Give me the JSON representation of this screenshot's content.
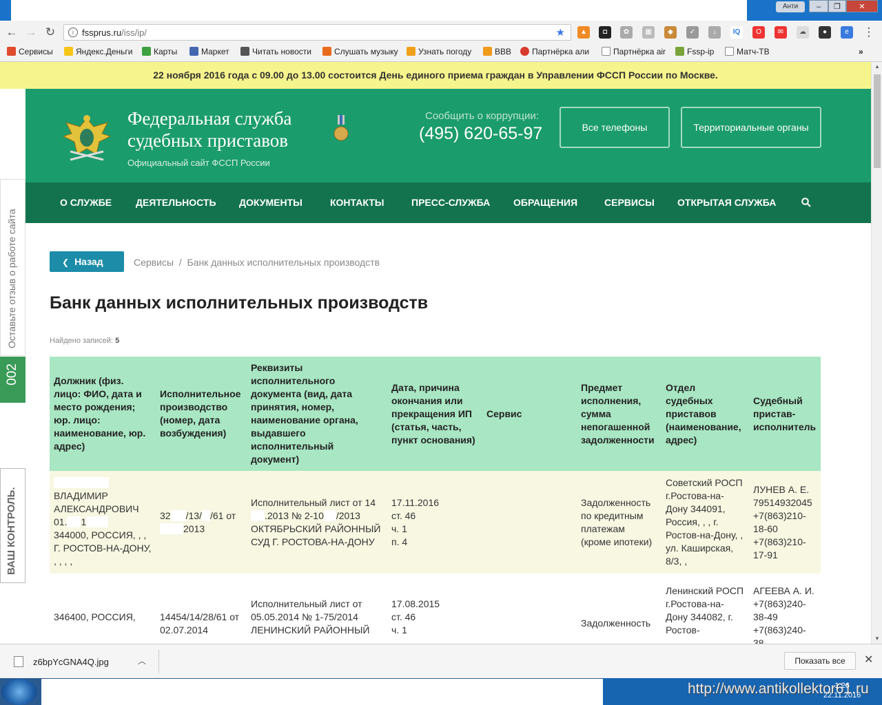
{
  "browser": {
    "titlebar": {
      "anti_label": "Анти",
      "minimize": "–",
      "maximize": "❐",
      "close": "✕"
    },
    "url_host": "fssprus.ru",
    "url_path": "/iss/ip/",
    "bookmarks": [
      {
        "label": "Сервисы",
        "color": "#e04b2e"
      },
      {
        "label": "Яндекс.Деньги",
        "color": "#f5c518"
      },
      {
        "label": "Карты",
        "color": "#3da13f"
      },
      {
        "label": "Маркет",
        "color": "#4468b0"
      },
      {
        "label": "Читать новости",
        "color": "#555555"
      },
      {
        "label": "Слушать музыку",
        "color": "#e86b1a"
      },
      {
        "label": "Узнать погоду",
        "color": "#f0a11a"
      },
      {
        "label": "ВВВ",
        "color": "#f09a1a"
      },
      {
        "label": "Партнёрка али",
        "color": "#d83a2e"
      },
      {
        "label": "Партнёрка air",
        "color": "#888888"
      },
      {
        "label": "Fssp-ip",
        "color": "#7aa33a"
      },
      {
        "label": "Матч-ТВ",
        "color": "#888888"
      }
    ]
  },
  "notice": "22 ноября 2016 года с 09.00 до 13.00 состоится День единого приема граждан в Управлении ФССП России по Москве.",
  "header": {
    "title": "Федеральная служба судебных приставов",
    "subtitle": "Официальный сайт ФССП России",
    "corruption_label": "Сообщить о коррупции:",
    "corruption_phone": "(495) 620-65-97",
    "btn_phones": "Все телефоны",
    "btn_regions": "Территориальные органы"
  },
  "nav": [
    "О СЛУЖБЕ",
    "ДЕЯТЕЛЬНОСТЬ",
    "ДОКУМЕНТЫ",
    "КОНТАКТЫ",
    "ПРЕСС-СЛУЖБА",
    "ОБРАЩЕНИЯ",
    "СЕРВИСЫ",
    "ОТКРЫТАЯ СЛУЖБА"
  ],
  "side": {
    "feedback": "Оставьте отзыв о работе сайта",
    "code": "002",
    "control": "ВАШ КОНТРОЛЬ."
  },
  "page": {
    "back": "Назад",
    "crumb1": "Сервисы",
    "crumb_sep": "/",
    "crumb2": "Банк данных исполнительных производств",
    "title": "Банк данных исполнительных производств",
    "found_label": "Найдено записей:",
    "found_count": "5"
  },
  "table": {
    "headers": [
      "Должник (физ. лицо: ФИО, дата и место рождения; юр. лицо: наименование, юр. адрес)",
      "Исполнительное производство (номер, дата возбуждения)",
      "Реквизиты исполнительного документа (вид, дата принятия, номер, наименование органа, выдавшего исполнительный документ)",
      "Дата, причина окончания или прекращения ИП (статья, часть, пункт основания)",
      "Сервис",
      "Предмет исполнения, сумма непогашенной задолженности",
      "Отдел судебных приставов (наименование, адрес)",
      "Судебный пристав-исполнитель"
    ],
    "rows": [
      {
        "debtor_name": "ВЛАДИМИР АЛЕКСАНДРОВИЧ",
        "debtor_dob_a": "01.",
        "debtor_dob_b": "1",
        "debtor_addr": "344000, РОССИЯ, , , Г. РОСТОВ-НА-ДОНУ, , , , ,",
        "ip_a": "32",
        "ip_b": "/13/",
        "ip_c": "/61 от",
        "ip_d": "2013",
        "doc_a": "Исполнительный лист от 14",
        "doc_b": ".2013 № 2-10",
        "doc_c": "/2013 ОКТЯБРЬСКИЙ РАЙОННЫЙ СУД Г. РОСТОВА-НА-ДОНУ",
        "end_date": "17.11.2016",
        "end_art": "ст. 46",
        "end_part": "ч. 1",
        "end_point": "п. 4",
        "service": "",
        "subject": "Задолженность по кредитным платежам (кроме ипотеки)",
        "dept": "Советский РОСП г.Ростова-на-Дону 344091, Россия, , , г. Ростов-на-Дону, , ул. Каширская, 8/3, ,",
        "bailiff_name": "ЛУНЕВ А. Е.",
        "bailiff_ph1": "79514932045",
        "bailiff_ph2": "+7(863)210-18-60",
        "bailiff_ph3": "+7(863)210-17-91"
      },
      {
        "debtor_addr": "346400, РОССИЯ,",
        "ip": "14454/14/28/61 от 02.07.2014",
        "doc": "Исполнительный лист от 05.05.2014 № 1-75/2014 ЛЕНИНСКИЙ РАЙОННЫЙ",
        "end_date": "17.08.2015",
        "end_art": "ст. 46",
        "end_part": "ч. 1",
        "service": "",
        "subject": "Задолженность",
        "dept": "Ленинский РОСП г.Ростова-на-Дону 344082, г. Ростов-",
        "bailiff_name": "АГЕЕВА А. И.",
        "bailiff_ph1": "+7(863)240-38-49",
        "bailiff_ph2": "+7(863)240-38-"
      }
    ]
  },
  "downloads": {
    "file": "z6bpYcGNA4Q.jpg",
    "show_all": "Показать все"
  },
  "taskbar": {
    "watermark": "http://www.antikollektor61.ru",
    "time": "1:26",
    "date": "22.11.2016"
  },
  "colors": {
    "notice": "#f6f48c",
    "header": "#1b9c6c",
    "nav": "#13734f",
    "table_head": "#a9e6c3",
    "row_highlight": "#f7f7e2",
    "back_btn": "#1c8ca8"
  }
}
